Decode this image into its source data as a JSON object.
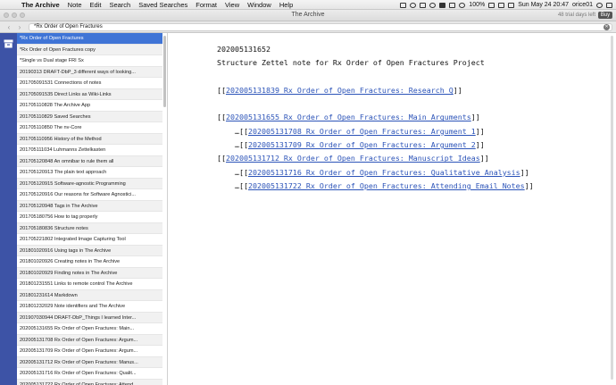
{
  "menubar": {
    "app_name": "The Archive",
    "menus": [
      "Note",
      "Edit",
      "Search",
      "Saved Searches",
      "Format",
      "View",
      "Window",
      "Help"
    ],
    "battery": "100%",
    "datetime": "Sun May 24  20:47",
    "user": "orice01"
  },
  "window": {
    "title": "The Archive",
    "trial_text": "48 trial days left",
    "buy_label": "Buy"
  },
  "search": {
    "value": "*Rx Order of Open Fractures"
  },
  "notes": [
    {
      "text": "*Rx Order of Open Fractures",
      "selected": true
    },
    {
      "text": "*Rx Order of Open Fractures copy"
    },
    {
      "text": "*Single vs Dual stage FRI Sx"
    },
    {
      "text": "20190313 DRAFT-DbP_3 different ways of looking..."
    },
    {
      "text": "201705091531 Connections of notes"
    },
    {
      "text": "201705091535 Direct Links as Wiki-Links"
    },
    {
      "text": "201705110828 The Archive App"
    },
    {
      "text": "201705110829 Saved Searches"
    },
    {
      "text": "201705110850 The nv-Core"
    },
    {
      "text": "201705110956 History of the Method"
    },
    {
      "text": "201705111034 Luhmanns Zettelkasten"
    },
    {
      "text": "201705120848 An omnibar to rule them all"
    },
    {
      "text": "201705120913 The plain text approach"
    },
    {
      "text": "201705120915 Software-agnostic Programming"
    },
    {
      "text": "201705120916 Our reasons for Software Agnostici..."
    },
    {
      "text": "201705120948 Tags in The Archive"
    },
    {
      "text": "201705180756 How to tag properly"
    },
    {
      "text": "201705180836 Structure notes"
    },
    {
      "text": "201705221802 Integrated Image Capturing Tool"
    },
    {
      "text": "201801020916 Using tags in The Archive"
    },
    {
      "text": "201801020926 Creating notes in The Archive"
    },
    {
      "text": "201801020929 Finding notes in The Archive"
    },
    {
      "text": "201801231551 Links to remote control The Archive"
    },
    {
      "text": "201801231614 Markdown"
    },
    {
      "text": "201801232029 Note identifiers and The Archive"
    },
    {
      "text": "201907030944 DRAFT-DbP_Things I learned Inter..."
    },
    {
      "text": "202005131655 Rx Order of Open Fractures: Main..."
    },
    {
      "text": "202005131708 Rx Order of Open Fractures: Argum..."
    },
    {
      "text": "202005131709 Rx Order of Open Fractures: Argum..."
    },
    {
      "text": "202005131712 Rx Order of Open Fractures: Manus..."
    },
    {
      "text": "202005131716 Rx Order of Open Fractures: Qualit..."
    },
    {
      "text": "202005131722 Rx Order of Open Fractures: Attend..."
    }
  ],
  "editor": {
    "lines": [
      {
        "prefix": "",
        "link": "",
        "suffix": "202005131652"
      },
      {
        "prefix": "",
        "link": "",
        "suffix": "Structure Zettel note for Rx Order of Open Fractures Project"
      },
      {
        "prefix": "",
        "link": "",
        "suffix": ""
      },
      {
        "prefix": "[[",
        "link": "202005131839 Rx Order of Open Fractures: Research Q",
        "suffix": "]]"
      },
      {
        "prefix": "",
        "link": "",
        "suffix": ""
      },
      {
        "prefix": "[[",
        "link": "202005131655 Rx Order of Open Fractures: Main Arguments",
        "suffix": "]]"
      },
      {
        "prefix": "    …[[",
        "link": "202005131708 Rx Order of Open Fractures: Argument 1",
        "suffix": "]]"
      },
      {
        "prefix": "    …[[",
        "link": "202005131709 Rx Order of Open Fractures: Argument 2",
        "suffix": "]]"
      },
      {
        "prefix": "[[",
        "link": "202005131712 Rx Order of Open Fractures: Manuscript Ideas",
        "suffix": "]]"
      },
      {
        "prefix": "    …[[",
        "link": "202005131716 Rx Order of Open Fractures: Qualitative Analysis",
        "suffix": "]]"
      },
      {
        "prefix": "    …[[",
        "link": "202005131722 Rx Order of Open Fractures: Attending Email Notes",
        "suffix": "]]"
      }
    ]
  },
  "colors": {
    "rail": "#3d53a6",
    "selection": "#3f74d6",
    "link": "#2b53b8"
  }
}
